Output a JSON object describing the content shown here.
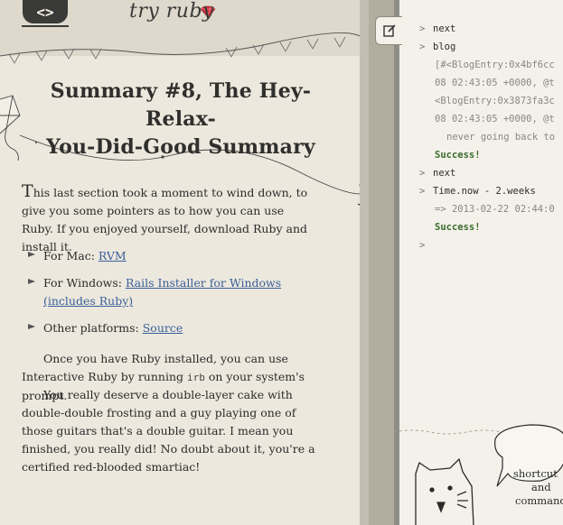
{
  "header": {
    "logo_glyph": "<>",
    "brand": "try ruby"
  },
  "lesson": {
    "title_line1": "Summary #8, The Hey-Relax-",
    "title_line2": "You-Did-Good Summary",
    "intro_dropcap": "T",
    "intro_rest": "his last section took a moment to wind down, to give you some pointers as to how you can use Ruby. If you enjoyed yourself, download Ruby and install it.",
    "bullets": [
      {
        "prefix": "For Mac: ",
        "link": "RVM"
      },
      {
        "prefix": "For Windows: ",
        "link": "Rails Installer for Windows (includes Ruby)"
      },
      {
        "prefix": "Other platforms: ",
        "link": "Source"
      }
    ],
    "para1_a": "Once you have Ruby installed, you can use Interactive Ruby by running ",
    "para1_code": "irb",
    "para1_b": " on your system's prompt.",
    "para2": "You really deserve a double-layer cake with double-double frosting and a guy playing one of those guitars that's a double guitar. I mean you finished, you really did! No doubt about it, you're a certified red-blooded smartiac!"
  },
  "console": {
    "lines": [
      {
        "kind": "cmd",
        "text": "next"
      },
      {
        "kind": "cmd",
        "text": "blog"
      },
      {
        "kind": "out",
        "text": "[#<BlogEntry:0x4bf6cc"
      },
      {
        "kind": "out",
        "text": "08 02:43:05 +0000, @t"
      },
      {
        "kind": "out",
        "text": "<BlogEntry:0x3873fa3c"
      },
      {
        "kind": "out",
        "text": "08 02:43:05 +0000, @t"
      },
      {
        "kind": "out2",
        "text": "never going back to"
      },
      {
        "kind": "ok",
        "text": "Success!"
      },
      {
        "kind": "cmd",
        "text": "next"
      },
      {
        "kind": "cmd",
        "text": "Time.now - 2.weeks"
      },
      {
        "kind": "out",
        "text": "=> 2013-02-22 02:44:0"
      },
      {
        "kind": "ok",
        "text": "Success!"
      },
      {
        "kind": "prompt",
        "text": ""
      }
    ],
    "prompt_symbol": ">",
    "bubble_line1": "shortcut",
    "bubble_line2": "and",
    "bubble_line3": "command"
  },
  "colors": {
    "link": "#3a5f9a",
    "success": "#3b6b2c",
    "gem": "#d2303a"
  }
}
